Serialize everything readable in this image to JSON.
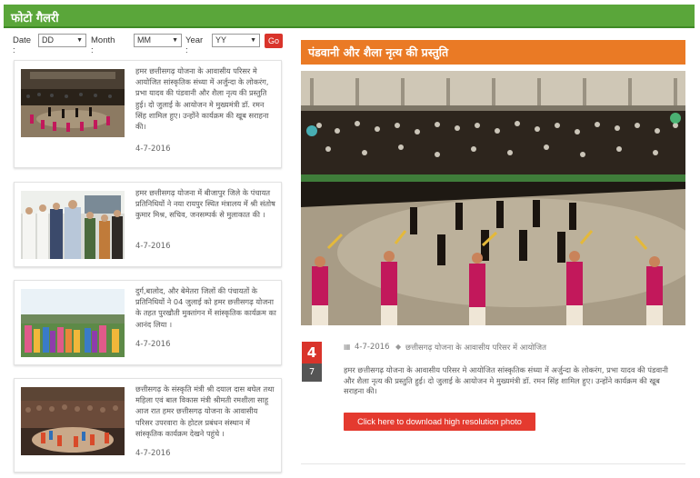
{
  "header": {
    "title": "फोटो गैलरी"
  },
  "filter": {
    "date_label": "Date :",
    "date_value": "DD",
    "month_label": "Month :",
    "month_value": "MM",
    "year_label": "Year :",
    "year_value": "YY",
    "go_label": "Go"
  },
  "gallery": [
    {
      "text": "हमर छत्तीसगढ़ योजना के आवासीय परिसर मे आयोजित सांस्कृतिक संध्या में अर्जुन्दा के लोकरंग, प्रभा यादव की पंडवानी और शैला नृत्य की प्रस्तुति हुई। दो जुलाई के आयोजन मे मुख्यमंत्री डॉ. रमन सिंह शामिल हुए। उन्होंने कार्यक्रम की खूब सराहना की।",
      "date": "4-7-2016"
    },
    {
      "text": "हमर छत्तीसगढ़ योजना में बीजापुर जिले के पंचायत प्रतिनिधियों ने नया रायपुर स्थित मंत्रालय में श्री संतोष कुमार मिश्र, सचिव, जनसम्पर्क से मुलाकात की ।",
      "date": "4-7-2016"
    },
    {
      "text": "दुर्ग,बालोद, और बेमेतरा जिलों की पंचायतों के प्रतिनिधियों ने 04 जुलाई को हमर छत्तीसगढ़ योजना के तहत पुरखौती मुक्तांगन में सांस्कृतिक कार्यक्रम का आनंद लिया ।",
      "date": "4-7-2016"
    },
    {
      "text": "छत्तीसगढ़ के संस्कृति मंत्री श्री दयाल दास बघेल तथा महिला एवं बाल विकास मंत्री श्रीमती रमशीला साहू आज रात हमर छत्तीसगढ़ योजना के आवासीय परिसर उपरवारा के होटल प्रबंधन संस्थान में सांस्कृतिक कार्यक्रम देखने पहुंचे ।",
      "date": "4-7-2016"
    }
  ],
  "feature": {
    "title": "पंडवानी और शैला नृत्य की प्रस्तुति",
    "day": "4",
    "month": "7",
    "date": "4-7-2016",
    "category": "छत्तीसगढ़ योजना के आवासीय परिसर में आयोजित",
    "description": "हमर छत्तीसगढ़ योजना के आवासीय परिसर मे आयोजित सांस्कृतिक संध्या में अर्जुन्दा के लोकरंग, प्रभा यादव की पंडवानी और शैला नृत्य की प्रस्तुति हुई। दो जुलाई के आयोजन मे मुख्यमंत्री डॉ. रमन सिंह शामिल हुए। उन्होंने कार्यक्रम की खूब सराहना की।",
    "download_label": "Click here to download high resolution photo"
  },
  "icons": {
    "calendar": "calendar-icon",
    "tag": "tag-icon",
    "dropdown": "chevron-down-icon"
  },
  "colors": {
    "header_green": "#5aa63a",
    "feature_orange": "#ea7a25",
    "accent_red": "#d9342b"
  }
}
